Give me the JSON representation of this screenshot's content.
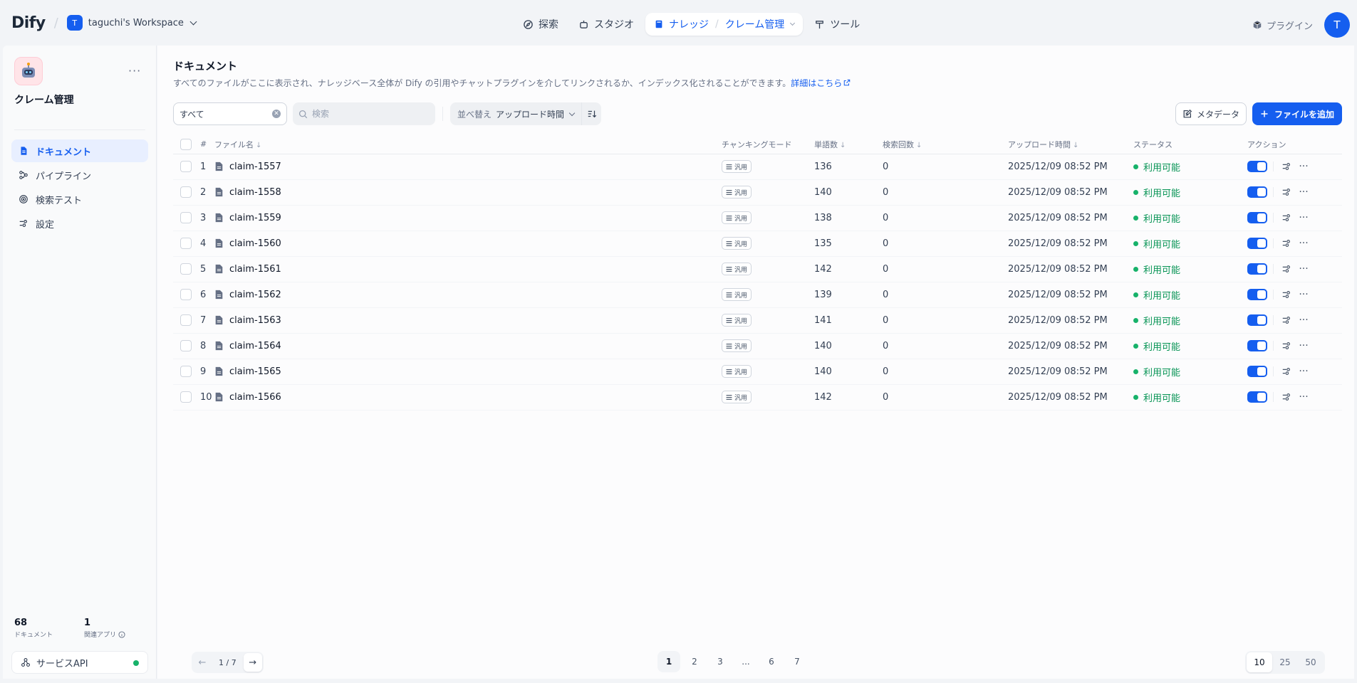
{
  "topbar": {
    "logo": "Dify",
    "workspace_badge": "T",
    "workspace_name": "taguchi's Workspace",
    "nav": {
      "explore": "探索",
      "studio": "スタジオ",
      "knowledge": "ナレッジ",
      "current_kb": "クレーム管理",
      "tools": "ツール"
    },
    "plugins": "プラグイン",
    "avatar": "T"
  },
  "sidebar": {
    "kb_name": "クレーム管理",
    "more": "···",
    "items": [
      {
        "label": "ドキュメント",
        "icon": "document-icon",
        "active": true
      },
      {
        "label": "パイプライン",
        "icon": "pipeline-icon",
        "active": false
      },
      {
        "label": "検索テスト",
        "icon": "target-icon",
        "active": false
      },
      {
        "label": "設定",
        "icon": "settings-icon",
        "active": false
      }
    ],
    "stats": {
      "doc_count": "68",
      "doc_label": "ドキュメント",
      "app_count": "1",
      "app_label": "関連アプリ"
    },
    "api_label": "サービスAPI",
    "api_status_color": "#17b26a"
  },
  "main": {
    "title": "ドキュメント",
    "description": "すべてのファイルがここに表示され、ナレッジベース全体が Dify の引用やチャットプラグインを介してリンクされるか、インデックス化されることができます。",
    "learn_more": "詳細はこちら",
    "filter": {
      "status_value": "すべて",
      "search_placeholder": "検索",
      "sort_prefix": "並べ替え",
      "sort_value": "アップロード時間"
    },
    "metadata_button": "メタデータ",
    "add_button": "ファイルを追加",
    "table": {
      "headers": {
        "index": "#",
        "name": "ファイル名",
        "chunk_mode": "チャンキングモード",
        "words": "単語数",
        "hits": "検索回数",
        "uploaded": "アップロード時間",
        "status": "ステータス",
        "actions": "アクション"
      },
      "rows": [
        {
          "index": "1",
          "name": "claim-1557",
          "mode": "汎用",
          "words": "136",
          "hits": "0",
          "uploaded": "2025/12/09 08:52 PM",
          "status": "利用可能"
        },
        {
          "index": "2",
          "name": "claim-1558",
          "mode": "汎用",
          "words": "140",
          "hits": "0",
          "uploaded": "2025/12/09 08:52 PM",
          "status": "利用可能"
        },
        {
          "index": "3",
          "name": "claim-1559",
          "mode": "汎用",
          "words": "138",
          "hits": "0",
          "uploaded": "2025/12/09 08:52 PM",
          "status": "利用可能"
        },
        {
          "index": "4",
          "name": "claim-1560",
          "mode": "汎用",
          "words": "135",
          "hits": "0",
          "uploaded": "2025/12/09 08:52 PM",
          "status": "利用可能"
        },
        {
          "index": "5",
          "name": "claim-1561",
          "mode": "汎用",
          "words": "142",
          "hits": "0",
          "uploaded": "2025/12/09 08:52 PM",
          "status": "利用可能"
        },
        {
          "index": "6",
          "name": "claim-1562",
          "mode": "汎用",
          "words": "139",
          "hits": "0",
          "uploaded": "2025/12/09 08:52 PM",
          "status": "利用可能"
        },
        {
          "index": "7",
          "name": "claim-1563",
          "mode": "汎用",
          "words": "141",
          "hits": "0",
          "uploaded": "2025/12/09 08:52 PM",
          "status": "利用可能"
        },
        {
          "index": "8",
          "name": "claim-1564",
          "mode": "汎用",
          "words": "140",
          "hits": "0",
          "uploaded": "2025/12/09 08:52 PM",
          "status": "利用可能"
        },
        {
          "index": "9",
          "name": "claim-1565",
          "mode": "汎用",
          "words": "140",
          "hits": "0",
          "uploaded": "2025/12/09 08:52 PM",
          "status": "利用可能"
        },
        {
          "index": "10",
          "name": "claim-1566",
          "mode": "汎用",
          "words": "142",
          "hits": "0",
          "uploaded": "2025/12/09 08:52 PM",
          "status": "利用可能"
        }
      ]
    },
    "pagination": {
      "indicator": "1 / 7",
      "pages": [
        "1",
        "2",
        "3",
        "...",
        "6",
        "7"
      ],
      "current": "1",
      "sizes": [
        "10",
        "25",
        "50"
      ],
      "current_size": "10"
    }
  },
  "colors": {
    "accent": "#155eef",
    "status_green": "#17b26a"
  }
}
